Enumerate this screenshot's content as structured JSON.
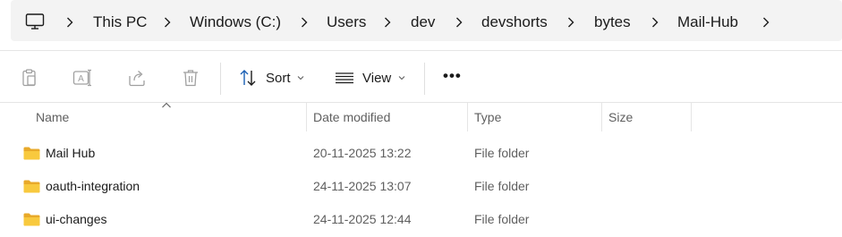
{
  "address_bar": {
    "root_icon": "computer-monitor-icon",
    "crumbs": [
      "This PC",
      "Windows (C:)",
      "Users",
      "dev",
      "devshorts",
      "bytes",
      "Mail-Hub"
    ],
    "separator_icon": "chevron-right-icon"
  },
  "toolbar": {
    "icons": [
      "paste-icon",
      "rename-icon",
      "share-icon",
      "delete-icon"
    ],
    "sort_label": "Sort",
    "view_label": "View",
    "more_label": "•••"
  },
  "columns": {
    "name": "Name",
    "date_modified": "Date modified",
    "type": "Type",
    "size": "Size"
  },
  "rows": [
    {
      "name": "Mail Hub",
      "date": "20-11-2025 13:22",
      "type": "File folder",
      "size": ""
    },
    {
      "name": "oauth-integration",
      "date": "24-11-2025 13:07",
      "type": "File folder",
      "size": ""
    },
    {
      "name": "ui-changes",
      "date": "24-11-2025 12:44",
      "type": "File folder",
      "size": ""
    }
  ],
  "colors": {
    "folder_yellow": "#f8c93e",
    "folder_dark": "#e8a92a",
    "disabled_icon": "#a0a0a0",
    "accent_blue": "#1a5fb4"
  }
}
